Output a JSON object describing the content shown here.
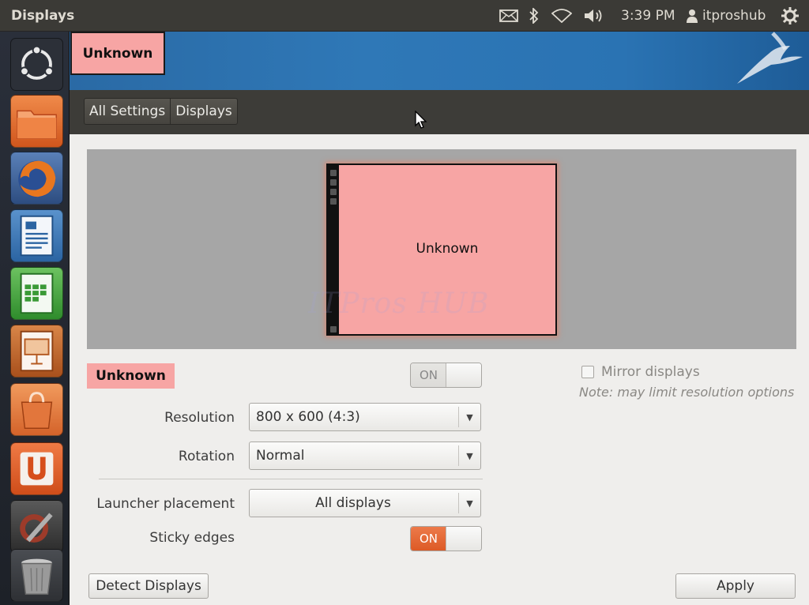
{
  "topbar": {
    "title": "Displays",
    "clock": "3:39 PM",
    "username": "itproshub"
  },
  "launcher": {
    "items": [
      {
        "name": "dash-home"
      },
      {
        "name": "files"
      },
      {
        "name": "firefox"
      },
      {
        "name": "libreoffice-writer"
      },
      {
        "name": "libreoffice-calc"
      },
      {
        "name": "libreoffice-impress"
      },
      {
        "name": "software-center"
      },
      {
        "name": "ubuntu-one"
      },
      {
        "name": "system-settings"
      },
      {
        "name": "trash"
      }
    ]
  },
  "window": {
    "tab_label": "Unknown",
    "breadcrumb": [
      "All Settings",
      "Displays"
    ]
  },
  "preview": {
    "monitor_label": "Unknown",
    "watermark": "ITPros HUB"
  },
  "display": {
    "name": "Unknown",
    "power_switch": {
      "state": "ON"
    },
    "resolution": {
      "label": "Resolution",
      "value": "800 x 600 (4:3)"
    },
    "rotation": {
      "label": "Rotation",
      "value": "Normal"
    },
    "launcher_placement": {
      "label": "Launcher placement",
      "value": "All displays"
    },
    "sticky_edges": {
      "label": "Sticky edges",
      "state": "ON"
    },
    "mirror": {
      "label": "Mirror displays",
      "checked": false,
      "note": "Note: may limit resolution options"
    }
  },
  "buttons": {
    "detect": "Detect Displays",
    "apply": "Apply"
  },
  "colors": {
    "monitor_fill": "#f7a5a4",
    "switch_on": "#dd5a26",
    "panel": "#3b3a36"
  }
}
